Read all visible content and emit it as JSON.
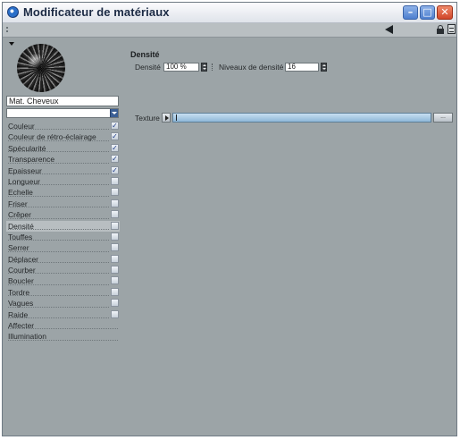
{
  "window": {
    "title": "Modificateur de matériaux"
  },
  "material": {
    "name": "Mat. Cheveux"
  },
  "channels": [
    {
      "label": "Couleur",
      "checked": true
    },
    {
      "label": "Couleur de rétro-éclairage",
      "checked": true
    },
    {
      "label": "Spécularité",
      "checked": true
    },
    {
      "label": "Transparence",
      "checked": true
    },
    {
      "label": "Epaisseur",
      "checked": true
    },
    {
      "label": "Longueur",
      "checked": false
    },
    {
      "label": "Echelle",
      "checked": false
    },
    {
      "label": "Friser",
      "checked": false
    },
    {
      "label": "Crêper",
      "checked": false
    },
    {
      "label": "Densité",
      "checked": false,
      "active": true
    },
    {
      "label": "Touffes",
      "checked": false
    },
    {
      "label": "Serrer",
      "checked": false
    },
    {
      "label": "Déplacer",
      "checked": false
    },
    {
      "label": "Courber",
      "checked": false
    },
    {
      "label": "Boucler",
      "checked": false
    },
    {
      "label": "Tordre",
      "checked": false
    },
    {
      "label": "Vagues",
      "checked": false
    },
    {
      "label": "Raide",
      "checked": false
    },
    {
      "label": "Affecter"
    },
    {
      "label": "Illumination"
    }
  ],
  "panel": {
    "title": "Densité",
    "density_label": "Densité",
    "density_value": "100 %",
    "levels_label": "Niveaux de densité",
    "levels_value": "16",
    "texture_label": "Texture",
    "browse_label": "..."
  },
  "icons": {
    "app": "app-icon",
    "back": "back-arrow-icon",
    "lock": "lock-icon",
    "menu": "menu-icon"
  },
  "colors": {
    "background": "#9ca4a7",
    "accent_blue": "#3b5f95",
    "texture_field": "#a9cbe6"
  }
}
